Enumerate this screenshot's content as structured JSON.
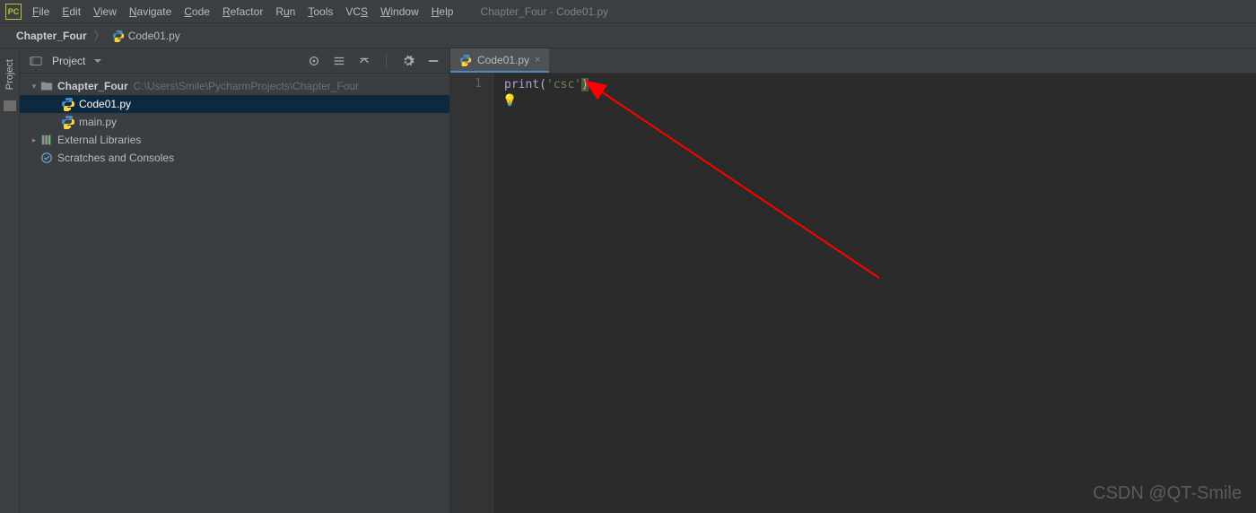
{
  "menubar": {
    "items": [
      {
        "label": "File",
        "mnemonic": "F"
      },
      {
        "label": "Edit",
        "mnemonic": "E"
      },
      {
        "label": "View",
        "mnemonic": "V"
      },
      {
        "label": "Navigate",
        "mnemonic": "N"
      },
      {
        "label": "Code",
        "mnemonic": "C"
      },
      {
        "label": "Refactor",
        "mnemonic": "R"
      },
      {
        "label": "Run",
        "mnemonic": "u"
      },
      {
        "label": "Tools",
        "mnemonic": "T"
      },
      {
        "label": "VCS",
        "mnemonic": "S"
      },
      {
        "label": "Window",
        "mnemonic": "W"
      },
      {
        "label": "Help",
        "mnemonic": "H"
      }
    ],
    "window_title": "Chapter_Four - Code01.py"
  },
  "breadcrumb": {
    "items": [
      {
        "label": "Chapter_Four"
      },
      {
        "label": "Code01.py"
      }
    ]
  },
  "side_tab": {
    "label": "Project"
  },
  "project_panel": {
    "title": "Project",
    "tree": {
      "root": {
        "label": "Chapter_Four",
        "path": "C:\\Users\\Smile\\PycharmProjects\\Chapter_Four"
      },
      "files": [
        {
          "label": "Code01.py"
        },
        {
          "label": "main.py"
        }
      ],
      "external_libs": "External Libraries",
      "scratches": "Scratches and Consoles"
    }
  },
  "editor": {
    "tab_label": "Code01.py",
    "line_number": "1",
    "code": {
      "fn": "print",
      "open": "(",
      "str": "'csc'",
      "close": ")"
    }
  },
  "watermark": "CSDN @QT-Smile"
}
